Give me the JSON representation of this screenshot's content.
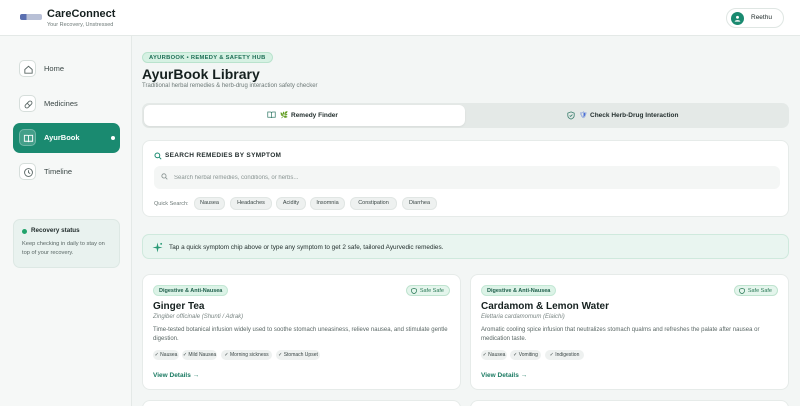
{
  "header": {
    "brand_title": "CareConnect",
    "brand_subtitle": "Your Recovery, Unstressed",
    "logo": "careconnect-logo",
    "user": {
      "initial_icon": "user-icon",
      "name": "Reethu"
    }
  },
  "sidebar": {
    "items": [
      {
        "label": "Home",
        "icon": "home-icon",
        "active": false
      },
      {
        "label": "Medicines",
        "icon": "pill-icon",
        "active": false
      },
      {
        "label": "AyurBook",
        "icon": "book-icon",
        "active": true
      },
      {
        "label": "Timeline",
        "icon": "clock-icon",
        "active": false
      }
    ],
    "recovery": {
      "title": "Recovery status",
      "text": "Keep checking in daily to stay on top of your recovery."
    }
  },
  "main": {
    "badge": "AYURBOOK • REMEDY & SAFETY HUB",
    "title": "AyurBook Library",
    "subtitle": "Traditional herbal remedies & herb-drug interaction safety checker",
    "tabs": [
      {
        "label": "Remedy Finder",
        "emoji": "🌿",
        "active": true
      },
      {
        "label": "Check Herb-Drug Interaction",
        "emoji": "🛡",
        "active": false
      }
    ],
    "search": {
      "title": "SEARCH REMEDIES BY SYMPTOM",
      "placeholder": "Search herbal remedies, conditions, or herbs...",
      "quick_label": "Quick Search:",
      "chips": [
        "Nausea",
        "Headaches",
        "Acidity",
        "Insomnia",
        "Constipation",
        "Diarrhea"
      ]
    },
    "tip": "Tap a quick symptom chip above or type any symptom to get 2 safe, tailored Ayurvedic remedies.",
    "cards": [
      {
        "category": "Digestive & Anti-Nausea",
        "safety": "Safe Safe",
        "title": "Ginger Tea",
        "latin": "Zingiber officinale (Shunti / Adrak)",
        "description": "Time-tested botanical infusion widely used to soothe stomach uneasiness, relieve nausea, and stimulate gentle digestion.",
        "tags": [
          "✓ Nausea",
          "✓ Mild Nausea",
          "✓ Morning sickness",
          "✓ Stomach Upset"
        ],
        "link": "View Details →"
      },
      {
        "category": "Digestive & Anti-Nausea",
        "safety": "Safe Safe",
        "title": "Cardamom & Lemon Water",
        "latin": "Elettaria cardamomum (Elaichi)",
        "description": "Aromatic cooling spice infusion that neutralizes stomach qualms and refreshes the palate after nausea or medication taste.",
        "tags": [
          "✓ Nausea",
          "✓ Vomiting",
          "✓ Indigestion"
        ],
        "link": "View Details →"
      }
    ]
  },
  "colors": {
    "accent": "#1a8a70",
    "safe": "#2b7a57",
    "background": "#f3f6f5"
  }
}
